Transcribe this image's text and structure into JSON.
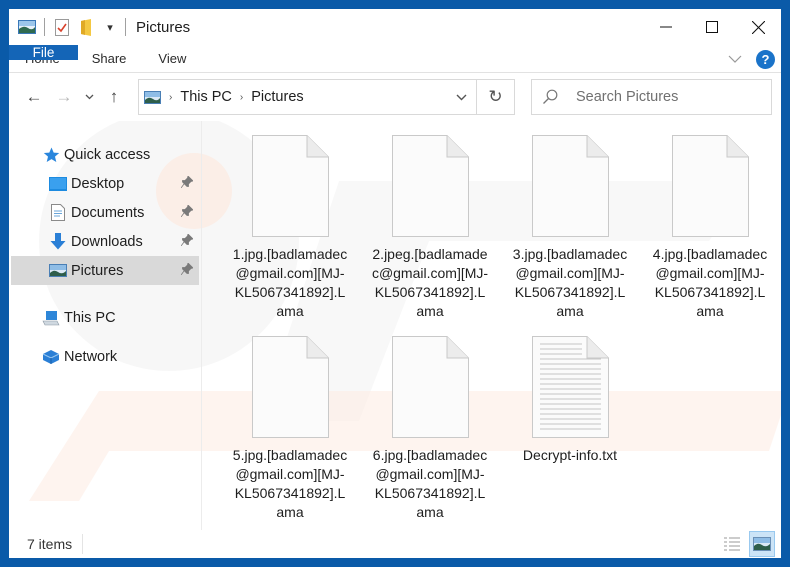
{
  "window": {
    "title": "Pictures",
    "controls": {
      "minimize": "—",
      "maximize": "☐",
      "close": "✕"
    }
  },
  "quick_access_toolbar": {
    "icons": [
      "pictures-folder-icon",
      "properties-icon",
      "new-folder-icon",
      "customize-dropdown-icon"
    ],
    "dropdown_glyph": "▾"
  },
  "ribbon": {
    "tabs": [
      {
        "label": "File",
        "active": true
      },
      {
        "label": "Home"
      },
      {
        "label": "Share"
      },
      {
        "label": "View"
      }
    ],
    "expand_glyph": "∨",
    "help_glyph": "?"
  },
  "navigation": {
    "back_glyph": "←",
    "forward_glyph": "→",
    "recent_glyph": "∨",
    "up_glyph": "↑",
    "breadcrumb": [
      "This PC",
      "Pictures"
    ],
    "breadcrumb_separator": "›",
    "dropdown_glyph": "∨",
    "refresh_glyph": "↻",
    "search_placeholder": "Search Pictures"
  },
  "sidebar": {
    "items": [
      {
        "label": "Quick access",
        "icon": "star-icon",
        "level": 0
      },
      {
        "label": "Desktop",
        "icon": "desktop-icon",
        "level": 1,
        "pinned": true
      },
      {
        "label": "Documents",
        "icon": "documents-icon",
        "level": 1,
        "pinned": true
      },
      {
        "label": "Downloads",
        "icon": "downloads-icon",
        "level": 1,
        "pinned": true
      },
      {
        "label": "Pictures",
        "icon": "pictures-icon",
        "level": 1,
        "pinned": true,
        "selected": true
      },
      {
        "label": "This PC",
        "icon": "computer-icon",
        "level": 0
      },
      {
        "label": "Network",
        "icon": "network-icon",
        "level": 0
      }
    ],
    "pin_glyph": "📌"
  },
  "files": [
    {
      "name": "1.jpg.[badlamadec@gmail.com][MJ-KL5067341892].Lama",
      "type": "blank"
    },
    {
      "name": "2.jpeg.[badlamadec@gmail.com][MJ-KL5067341892].Lama",
      "type": "blank"
    },
    {
      "name": "3.jpg.[badlamadec@gmail.com][MJ-KL5067341892].Lama",
      "type": "blank"
    },
    {
      "name": "4.jpg.[badlamadec@gmail.com][MJ-KL5067341892].Lama",
      "type": "blank"
    },
    {
      "name": "5.jpg.[badlamadec@gmail.com][MJ-KL5067341892].Lama",
      "type": "blank"
    },
    {
      "name": "6.jpg.[badlamadec@gmail.com][MJ-KL5067341892].Lama",
      "type": "blank"
    },
    {
      "name": "Decrypt-info.txt",
      "type": "text"
    }
  ],
  "status": {
    "item_count": "7 items",
    "views": [
      {
        "name": "details-view",
        "active": false
      },
      {
        "name": "large-icons-view",
        "active": true
      }
    ]
  },
  "colors": {
    "accent": "#1465b7",
    "frame": "#0a5aa8",
    "selected_nav": "#d9d9d9"
  }
}
